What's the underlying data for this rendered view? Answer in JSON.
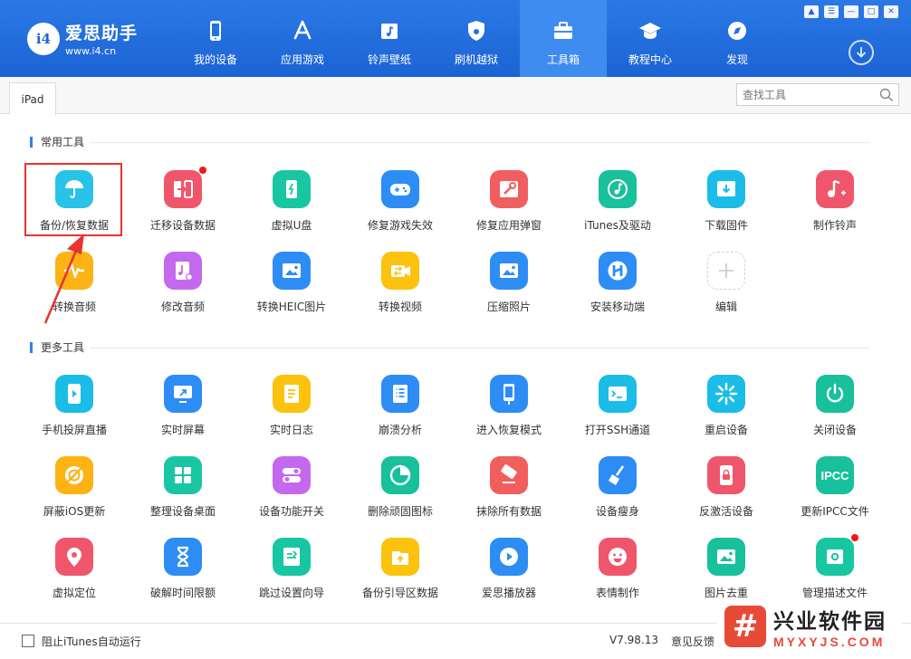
{
  "app": {
    "logo_mark": "i4",
    "name": "爱思助手",
    "url": "www.i4.cn"
  },
  "nav": [
    {
      "label": "我的设备",
      "icon": "phone-icon"
    },
    {
      "label": "应用游戏",
      "icon": "app-store-icon"
    },
    {
      "label": "铃声壁纸",
      "icon": "music-wallpaper-icon"
    },
    {
      "label": "刷机越狱",
      "icon": "shield-icon"
    },
    {
      "label": "工具箱",
      "icon": "toolbox-icon",
      "active": true
    },
    {
      "label": "教程中心",
      "icon": "graduation-cap-icon"
    },
    {
      "label": "发现",
      "icon": "compass-icon"
    }
  ],
  "window_controls": [
    "shirt-icon",
    "menu-icon",
    "minimize-icon",
    "maximize-icon",
    "close-icon"
  ],
  "device_tab": "iPad",
  "search": {
    "placeholder": "查找工具"
  },
  "sections": {
    "common": "常用工具",
    "more": "更多工具"
  },
  "common_tools": [
    {
      "label": "备份/恢复数据",
      "icon": "umbrella-icon",
      "color": "#29c2e8"
    },
    {
      "label": "迁移设备数据",
      "icon": "transfer-icon",
      "color": "#f0566b",
      "badge": true
    },
    {
      "label": "虚拟U盘",
      "icon": "usb-drive-icon",
      "color": "#19c6a2"
    },
    {
      "label": "修复游戏失效",
      "icon": "gamepad-icon",
      "color": "#2d8df5"
    },
    {
      "label": "修复应用弹窗",
      "icon": "wrench-icon",
      "color": "#f05e5e"
    },
    {
      "label": "iTunes及驱动",
      "icon": "itunes-icon",
      "color": "#18c09b"
    },
    {
      "label": "下载固件",
      "icon": "download-firmware-icon",
      "color": "#1bbde8"
    },
    {
      "label": "制作铃声",
      "icon": "ringtone-icon",
      "color": "#f0566b"
    },
    {
      "label": "转换音频",
      "icon": "audio-wave-icon",
      "color": "#fcb313"
    },
    {
      "label": "修改音频",
      "icon": "edit-audio-icon",
      "color": "#c469ee"
    },
    {
      "label": "转换HEIC图片",
      "icon": "heic-image-icon",
      "color": "#2d8df5"
    },
    {
      "label": "转换视频",
      "icon": "video-convert-icon",
      "color": "#fcc20d"
    },
    {
      "label": "压缩照片",
      "icon": "photo-compress-icon",
      "color": "#2d8df5"
    },
    {
      "label": "安装移动端",
      "icon": "install-mobile-icon",
      "color": "#2d8df5"
    },
    {
      "label": "编辑",
      "icon": "plus-icon",
      "color": "#ffffff",
      "edit": true
    }
  ],
  "more_tools": [
    {
      "label": "手机投屏直播",
      "icon": "screen-cast-icon",
      "color": "#1bbde8"
    },
    {
      "label": "实时屏幕",
      "icon": "realtime-screen-icon",
      "color": "#2d8df5"
    },
    {
      "label": "实时日志",
      "icon": "log-icon",
      "color": "#fcc20d"
    },
    {
      "label": "崩溃分析",
      "icon": "crash-analysis-icon",
      "color": "#2d8df5"
    },
    {
      "label": "进入恢复模式",
      "icon": "recovery-mode-icon",
      "color": "#2d8df5"
    },
    {
      "label": "打开SSH通道",
      "icon": "terminal-icon",
      "color": "#1bbde8"
    },
    {
      "label": "重启设备",
      "icon": "restart-icon",
      "color": "#1bbde8"
    },
    {
      "label": "关闭设备",
      "icon": "power-icon",
      "color": "#18c09b"
    },
    {
      "label": "屏蔽iOS更新",
      "icon": "block-update-icon",
      "color": "#fcb313"
    },
    {
      "label": "整理设备桌面",
      "icon": "desktop-grid-icon",
      "color": "#19c6a2"
    },
    {
      "label": "设备功能开关",
      "icon": "toggle-icon",
      "color": "#c469ee"
    },
    {
      "label": "删除顽固图标",
      "icon": "delete-icon-icon",
      "color": "#18c09b"
    },
    {
      "label": "抹除所有数据",
      "icon": "eraser-icon",
      "color": "#f05e5e"
    },
    {
      "label": "设备瘦身",
      "icon": "broom-icon",
      "color": "#2d8df5"
    },
    {
      "label": "反激活设备",
      "icon": "deactivate-icon",
      "color": "#f0566b"
    },
    {
      "label": "更新IPCC文件",
      "icon": "ipcc-icon",
      "color": "#18c09b",
      "icon_text": "IPCC"
    },
    {
      "label": "虚拟定位",
      "icon": "location-pin-icon",
      "color": "#f0566b"
    },
    {
      "label": "破解时间限额",
      "icon": "hourglass-icon",
      "color": "#2d8df5"
    },
    {
      "label": "跳过设置向导",
      "icon": "skip-wizard-icon",
      "color": "#19c6a2"
    },
    {
      "label": "备份引导区数据",
      "icon": "backup-boot-icon",
      "color": "#fcc20d"
    },
    {
      "label": "爱思播放器",
      "icon": "player-icon",
      "color": "#2d8df5"
    },
    {
      "label": "表情制作",
      "icon": "emoji-icon",
      "color": "#f0566b"
    },
    {
      "label": "图片去重",
      "icon": "image-dedupe-icon",
      "color": "#18c09b"
    },
    {
      "label": "管理描述文件",
      "icon": "profile-gear-icon",
      "color": "#19c6a2",
      "badge": true
    }
  ],
  "footer": {
    "itunes_checkbox_label": "阻止iTunes自动运行",
    "version": "V7.98.13",
    "feedback": "意见反馈"
  },
  "watermark": {
    "mark": "#",
    "cn": "兴业软件园",
    "en": "MYXYJS.COM"
  }
}
